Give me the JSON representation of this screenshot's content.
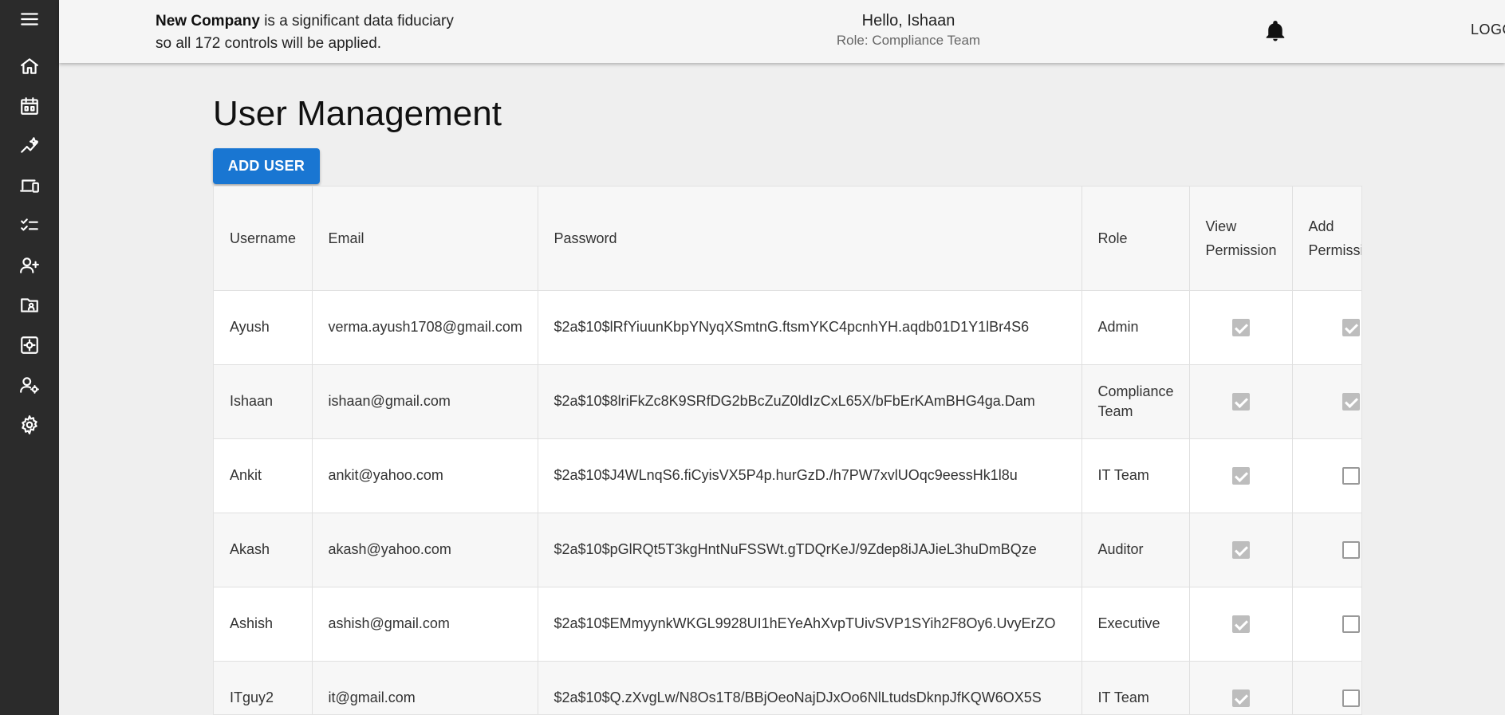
{
  "header": {
    "company_name": "New Company",
    "notice_rest_1": "is a significant data fiduciary",
    "notice_line_2": "so all 172 controls will be applied.",
    "greeting": "Hello, Ishaan",
    "role": "Role: Compliance Team",
    "logout_label": "LOGOUT"
  },
  "sidebar": {
    "icons": [
      "menu-icon",
      "home-icon",
      "calendar-icon",
      "analytics-icon",
      "devices-icon",
      "checklist-icon",
      "add-user-icon",
      "contact-folder-icon",
      "settings-box-icon",
      "user-settings-icon",
      "gear-icon"
    ]
  },
  "page": {
    "title": "User Management",
    "add_user_label": "ADD USER"
  },
  "table": {
    "headers": {
      "username": "Username",
      "email": "Email",
      "password": "Password",
      "role": "Role",
      "view_permission_1": "View",
      "view_permission_2": "Permission",
      "add_permission_1": "Add",
      "add_permission_2": "Permissi"
    },
    "rows": [
      {
        "username": "Ayush",
        "email": "verma.ayush1708@gmail.com",
        "password": "$2a$10$lRfYiuunKbpYNyqXSmtnG.ftsmYKC4pcnhYH.aqdb01D1Y1lBr4S6",
        "role": "Admin",
        "view": true,
        "add": true
      },
      {
        "username": "Ishaan",
        "email": "ishaan@gmail.com",
        "password": "$2a$10$8lriFkZc8K9SRfDG2bBcZuZ0ldIzCxL65X/bFbErKAmBHG4ga.Dam",
        "role": "Compliance Team",
        "view": true,
        "add": true
      },
      {
        "username": "Ankit",
        "email": "ankit@yahoo.com",
        "password": "$2a$10$J4WLnqS6.fiCyisVX5P4p.hurGzD./h7PW7xvlUOqc9eessHk1l8u",
        "role": "IT Team",
        "view": true,
        "add": false
      },
      {
        "username": "Akash",
        "email": "akash@yahoo.com",
        "password": "$2a$10$pGlRQt5T3kgHntNuFSSWt.gTDQrKeJ/9Zdep8iJAJieL3huDmBQze",
        "role": "Auditor",
        "view": true,
        "add": false
      },
      {
        "username": "Ashish",
        "email": "ashish@gmail.com",
        "password": "$2a$10$EMmyynkWKGL9928UI1hEYeAhXvpTUivSVP1SYih2F8Oy6.UvyErZO",
        "role": "Executive",
        "view": true,
        "add": false
      },
      {
        "username": "ITguy2",
        "email": "it@gmail.com",
        "password": "$2a$10$Q.zXvgLw/N8Os1T8/BBjOeoNajDJxOo6NlLtudsDknpJfKQW6OX5S",
        "role": "IT Team",
        "view": true,
        "add": false
      }
    ]
  }
}
